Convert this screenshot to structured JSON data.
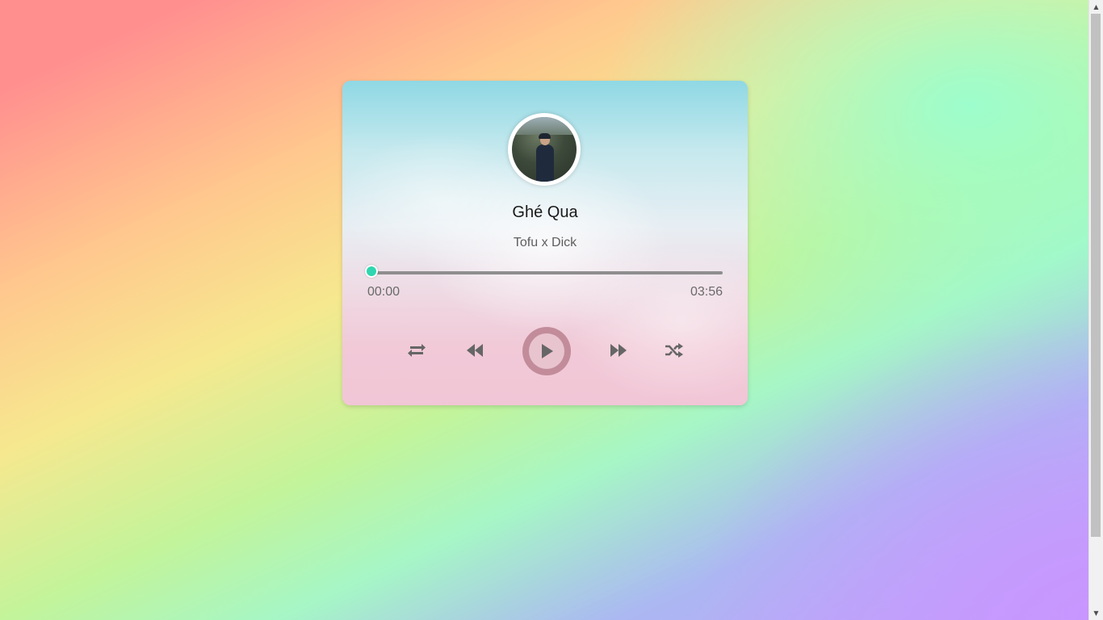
{
  "player": {
    "song_title": "Ghé Qua",
    "artist": "Tofu x Dick",
    "current_time": "00:00",
    "total_time": "03:56",
    "progress_fraction": 0.0,
    "accent_color": "#2fd6b0",
    "play_button_color": "#c28c9b"
  },
  "controls": {
    "repeat_icon": "repeat-icon",
    "prev_icon": "rewind-icon",
    "play_icon": "play-icon",
    "next_icon": "fast-forward-icon",
    "shuffle_icon": "shuffle-icon"
  }
}
